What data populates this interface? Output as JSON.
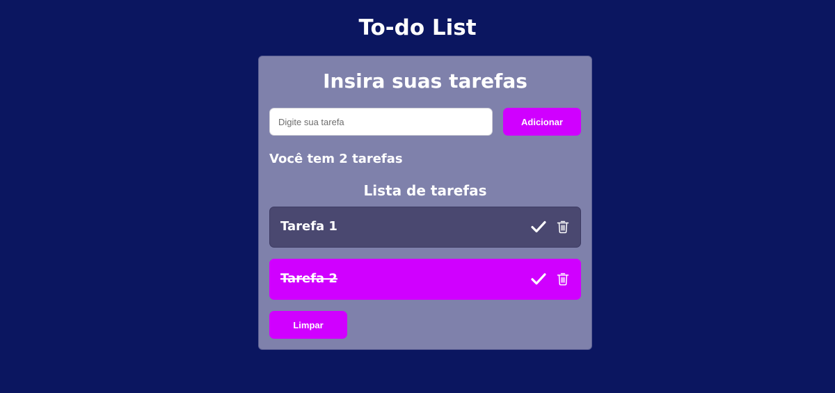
{
  "header": {
    "title": "To-do List"
  },
  "card": {
    "title": "Insira suas tarefas",
    "input": {
      "value": "",
      "placeholder": "Digite sua tarefa"
    },
    "add_label": "Adicionar",
    "task_count_text": "Você tem 2 tarefas",
    "list_title": "Lista de tarefas",
    "tasks": [
      {
        "label": "Tarefa 1",
        "completed": false,
        "bg": "#4a4870"
      },
      {
        "label": "Tarefa 2",
        "completed": true,
        "bg": "#d000ff"
      }
    ],
    "clear_label": "Limpar"
  },
  "icons": {
    "complete": "check-icon",
    "delete": "trash-icon"
  },
  "colors": {
    "background": "#0b1660",
    "card": "#7f81ab",
    "accent": "#d000ff",
    "task_pending": "#4a4870",
    "text": "#ffffff"
  }
}
